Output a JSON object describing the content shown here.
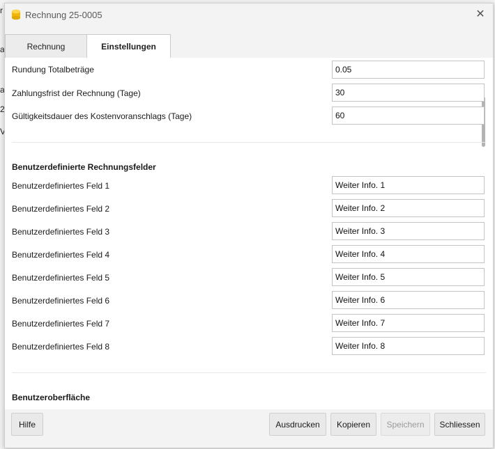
{
  "dialog": {
    "title": "Rechnung 25-0005",
    "app_icon": "database-icon",
    "close_icon": "close-icon",
    "close_glyph": "✕"
  },
  "background_fragments": [
    "r",
    "a",
    "a",
    "2",
    "V"
  ],
  "tabs": [
    {
      "label": "Rechnung",
      "active": false
    },
    {
      "label": "Einstellungen",
      "active": true
    }
  ],
  "settings": [
    {
      "label": "Rundung Totalbeträge",
      "value": "0.05"
    },
    {
      "label": "Zahlungsfrist der Rechnung (Tage)",
      "value": "30"
    },
    {
      "label": "Gültigkeitsdauer des Kostenvoranschlags (Tage)",
      "value": "60"
    }
  ],
  "custom_fields": {
    "heading": "Benutzerdefinierte Rechnungsfelder",
    "items": [
      {
        "label": "Benutzerdefiniertes Feld 1",
        "value": "Weiter Info. 1"
      },
      {
        "label": "Benutzerdefiniertes Feld 2",
        "value": "Weiter Info. 2"
      },
      {
        "label": "Benutzerdefiniertes Feld 3",
        "value": "Weiter Info. 3"
      },
      {
        "label": "Benutzerdefiniertes Feld 4",
        "value": "Weiter Info. 4"
      },
      {
        "label": "Benutzerdefiniertes Feld 5",
        "value": "Weiter Info. 5"
      },
      {
        "label": "Benutzerdefiniertes Feld 6",
        "value": "Weiter Info. 6"
      },
      {
        "label": "Benutzerdefiniertes Feld 7",
        "value": "Weiter Info. 7"
      },
      {
        "label": "Benutzerdefiniertes Feld 8",
        "value": "Weiter Info. 8"
      }
    ]
  },
  "ui_section": {
    "heading": "Benutzeroberfläche"
  },
  "footer": {
    "help": "Hilfe",
    "print": "Ausdrucken",
    "copy": "Kopieren",
    "save": "Speichern",
    "save_disabled": true,
    "close": "Schliessen"
  },
  "colors": {
    "accent_icon": "#f2b705",
    "disabled_text": "#9a9a9a"
  }
}
